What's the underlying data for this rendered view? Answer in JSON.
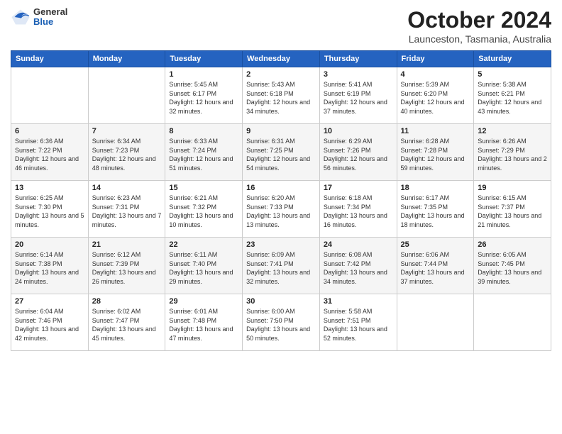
{
  "header": {
    "logo": {
      "general": "General",
      "blue": "Blue"
    },
    "title": "October 2024",
    "location": "Launceston, Tasmania, Australia"
  },
  "weekdays": [
    "Sunday",
    "Monday",
    "Tuesday",
    "Wednesday",
    "Thursday",
    "Friday",
    "Saturday"
  ],
  "weeks": [
    [
      {
        "day": "",
        "sunrise": "",
        "sunset": "",
        "daylight": ""
      },
      {
        "day": "",
        "sunrise": "",
        "sunset": "",
        "daylight": ""
      },
      {
        "day": "1",
        "sunrise": "Sunrise: 5:45 AM",
        "sunset": "Sunset: 6:17 PM",
        "daylight": "Daylight: 12 hours and 32 minutes."
      },
      {
        "day": "2",
        "sunrise": "Sunrise: 5:43 AM",
        "sunset": "Sunset: 6:18 PM",
        "daylight": "Daylight: 12 hours and 34 minutes."
      },
      {
        "day": "3",
        "sunrise": "Sunrise: 5:41 AM",
        "sunset": "Sunset: 6:19 PM",
        "daylight": "Daylight: 12 hours and 37 minutes."
      },
      {
        "day": "4",
        "sunrise": "Sunrise: 5:39 AM",
        "sunset": "Sunset: 6:20 PM",
        "daylight": "Daylight: 12 hours and 40 minutes."
      },
      {
        "day": "5",
        "sunrise": "Sunrise: 5:38 AM",
        "sunset": "Sunset: 6:21 PM",
        "daylight": "Daylight: 12 hours and 43 minutes."
      }
    ],
    [
      {
        "day": "6",
        "sunrise": "Sunrise: 6:36 AM",
        "sunset": "Sunset: 7:22 PM",
        "daylight": "Daylight: 12 hours and 46 minutes."
      },
      {
        "day": "7",
        "sunrise": "Sunrise: 6:34 AM",
        "sunset": "Sunset: 7:23 PM",
        "daylight": "Daylight: 12 hours and 48 minutes."
      },
      {
        "day": "8",
        "sunrise": "Sunrise: 6:33 AM",
        "sunset": "Sunset: 7:24 PM",
        "daylight": "Daylight: 12 hours and 51 minutes."
      },
      {
        "day": "9",
        "sunrise": "Sunrise: 6:31 AM",
        "sunset": "Sunset: 7:25 PM",
        "daylight": "Daylight: 12 hours and 54 minutes."
      },
      {
        "day": "10",
        "sunrise": "Sunrise: 6:29 AM",
        "sunset": "Sunset: 7:26 PM",
        "daylight": "Daylight: 12 hours and 56 minutes."
      },
      {
        "day": "11",
        "sunrise": "Sunrise: 6:28 AM",
        "sunset": "Sunset: 7:28 PM",
        "daylight": "Daylight: 12 hours and 59 minutes."
      },
      {
        "day": "12",
        "sunrise": "Sunrise: 6:26 AM",
        "sunset": "Sunset: 7:29 PM",
        "daylight": "Daylight: 13 hours and 2 minutes."
      }
    ],
    [
      {
        "day": "13",
        "sunrise": "Sunrise: 6:25 AM",
        "sunset": "Sunset: 7:30 PM",
        "daylight": "Daylight: 13 hours and 5 minutes."
      },
      {
        "day": "14",
        "sunrise": "Sunrise: 6:23 AM",
        "sunset": "Sunset: 7:31 PM",
        "daylight": "Daylight: 13 hours and 7 minutes."
      },
      {
        "day": "15",
        "sunrise": "Sunrise: 6:21 AM",
        "sunset": "Sunset: 7:32 PM",
        "daylight": "Daylight: 13 hours and 10 minutes."
      },
      {
        "day": "16",
        "sunrise": "Sunrise: 6:20 AM",
        "sunset": "Sunset: 7:33 PM",
        "daylight": "Daylight: 13 hours and 13 minutes."
      },
      {
        "day": "17",
        "sunrise": "Sunrise: 6:18 AM",
        "sunset": "Sunset: 7:34 PM",
        "daylight": "Daylight: 13 hours and 16 minutes."
      },
      {
        "day": "18",
        "sunrise": "Sunrise: 6:17 AM",
        "sunset": "Sunset: 7:35 PM",
        "daylight": "Daylight: 13 hours and 18 minutes."
      },
      {
        "day": "19",
        "sunrise": "Sunrise: 6:15 AM",
        "sunset": "Sunset: 7:37 PM",
        "daylight": "Daylight: 13 hours and 21 minutes."
      }
    ],
    [
      {
        "day": "20",
        "sunrise": "Sunrise: 6:14 AM",
        "sunset": "Sunset: 7:38 PM",
        "daylight": "Daylight: 13 hours and 24 minutes."
      },
      {
        "day": "21",
        "sunrise": "Sunrise: 6:12 AM",
        "sunset": "Sunset: 7:39 PM",
        "daylight": "Daylight: 13 hours and 26 minutes."
      },
      {
        "day": "22",
        "sunrise": "Sunrise: 6:11 AM",
        "sunset": "Sunset: 7:40 PM",
        "daylight": "Daylight: 13 hours and 29 minutes."
      },
      {
        "day": "23",
        "sunrise": "Sunrise: 6:09 AM",
        "sunset": "Sunset: 7:41 PM",
        "daylight": "Daylight: 13 hours and 32 minutes."
      },
      {
        "day": "24",
        "sunrise": "Sunrise: 6:08 AM",
        "sunset": "Sunset: 7:42 PM",
        "daylight": "Daylight: 13 hours and 34 minutes."
      },
      {
        "day": "25",
        "sunrise": "Sunrise: 6:06 AM",
        "sunset": "Sunset: 7:44 PM",
        "daylight": "Daylight: 13 hours and 37 minutes."
      },
      {
        "day": "26",
        "sunrise": "Sunrise: 6:05 AM",
        "sunset": "Sunset: 7:45 PM",
        "daylight": "Daylight: 13 hours and 39 minutes."
      }
    ],
    [
      {
        "day": "27",
        "sunrise": "Sunrise: 6:04 AM",
        "sunset": "Sunset: 7:46 PM",
        "daylight": "Daylight: 13 hours and 42 minutes."
      },
      {
        "day": "28",
        "sunrise": "Sunrise: 6:02 AM",
        "sunset": "Sunset: 7:47 PM",
        "daylight": "Daylight: 13 hours and 45 minutes."
      },
      {
        "day": "29",
        "sunrise": "Sunrise: 6:01 AM",
        "sunset": "Sunset: 7:48 PM",
        "daylight": "Daylight: 13 hours and 47 minutes."
      },
      {
        "day": "30",
        "sunrise": "Sunrise: 6:00 AM",
        "sunset": "Sunset: 7:50 PM",
        "daylight": "Daylight: 13 hours and 50 minutes."
      },
      {
        "day": "31",
        "sunrise": "Sunrise: 5:58 AM",
        "sunset": "Sunset: 7:51 PM",
        "daylight": "Daylight: 13 hours and 52 minutes."
      },
      {
        "day": "",
        "sunrise": "",
        "sunset": "",
        "daylight": ""
      },
      {
        "day": "",
        "sunrise": "",
        "sunset": "",
        "daylight": ""
      }
    ]
  ]
}
